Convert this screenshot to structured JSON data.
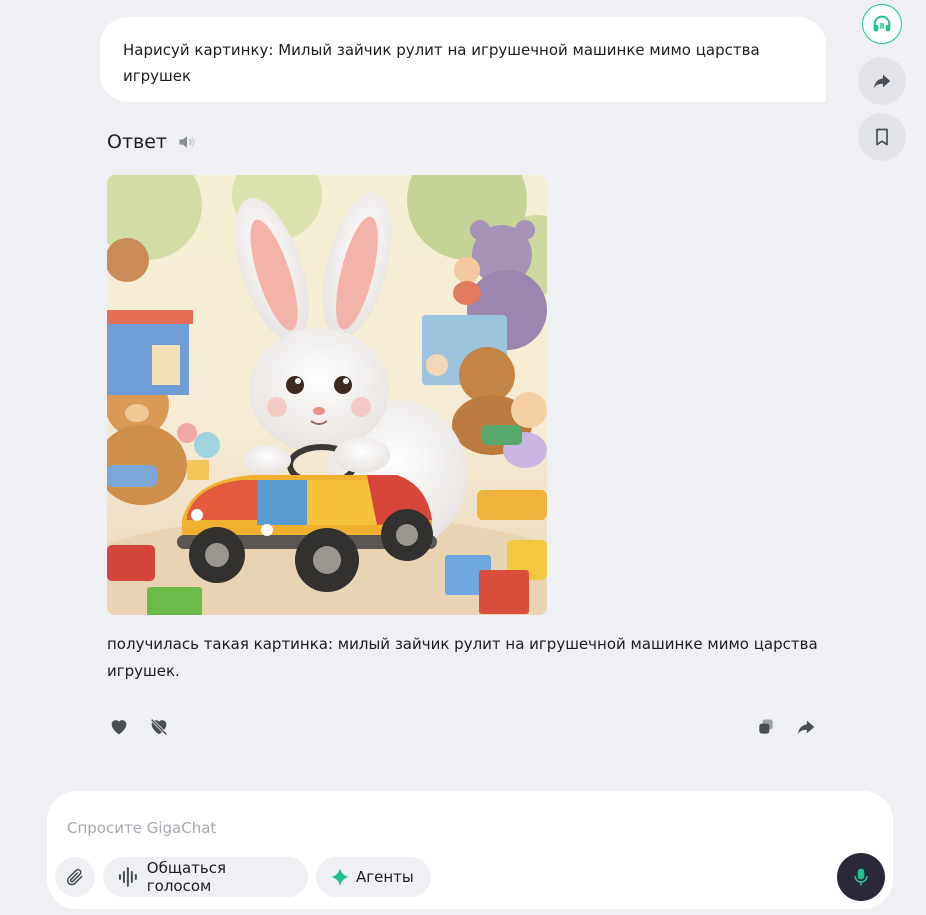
{
  "user_message": "Нарисуй картинку: Милый зайчик рулит на игрушечной машинке мимо царства игрушек",
  "answer": {
    "title": "Ответ",
    "text": "получилась такая картинка: милый зайчик рулит на игрушечной машинке мимо царства игрушек."
  },
  "side_actions": [
    "headphones-icon",
    "share-icon",
    "bookmark-icon"
  ],
  "reactions": [
    "heart-icon",
    "dislike-icon",
    "copy-icon",
    "forward-icon"
  ],
  "composer": {
    "placeholder": "Спросите GigaChat",
    "voice_label": "Общаться голосом",
    "agents_label": "Агенты"
  },
  "colors": {
    "background": "#eef0f3",
    "accent_green": "#21c08c",
    "mic_button": "#2b2638"
  }
}
